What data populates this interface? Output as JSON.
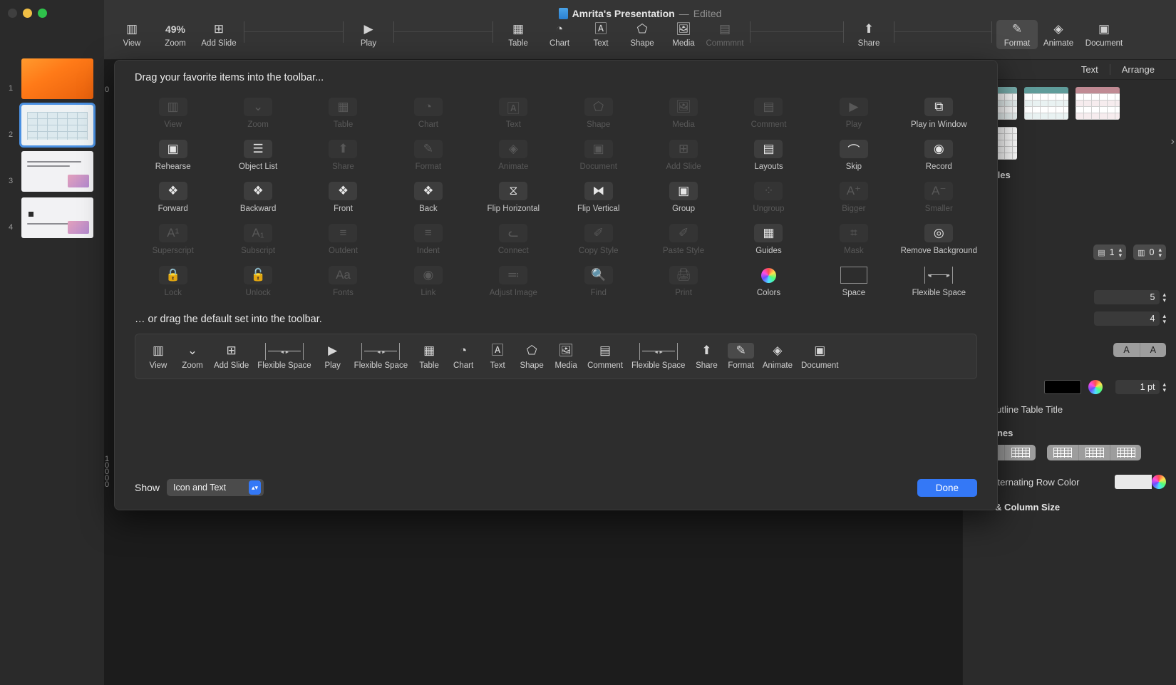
{
  "window": {
    "title": "Amrita's Presentation",
    "separator": "—",
    "edited": "Edited",
    "doc_icon": "document-icon"
  },
  "traffic_lights": {
    "close": "close",
    "minimize": "minimize",
    "maximize": "maximize"
  },
  "toolbar": {
    "items": [
      {
        "label": "View",
        "icon": "sidebar-icon",
        "state": "normal"
      },
      {
        "label": "Zoom",
        "icon": "49% ⌄",
        "value": "49%",
        "state": "normal"
      },
      {
        "label": "Add Slide",
        "icon": "plus-box-icon",
        "state": "normal"
      },
      {
        "label": "Play",
        "icon": "play-icon",
        "state": "normal"
      },
      {
        "label": "Table",
        "icon": "table-icon",
        "state": "normal"
      },
      {
        "label": "Chart",
        "icon": "chart-icon",
        "state": "normal"
      },
      {
        "label": "Text",
        "icon": "text-icon",
        "state": "normal"
      },
      {
        "label": "Shape",
        "icon": "shape-icon",
        "state": "normal"
      },
      {
        "label": "Media",
        "icon": "media-icon",
        "state": "normal"
      },
      {
        "label": "Commmnt",
        "icon": "comment-icon",
        "state": "dim"
      },
      {
        "label": "Share",
        "icon": "share-icon",
        "state": "normal"
      },
      {
        "label": "Format",
        "icon": "format-brush-icon",
        "state": "active"
      },
      {
        "label": "Animate",
        "icon": "animate-icon",
        "state": "normal"
      },
      {
        "label": "Document",
        "icon": "document-panel-icon",
        "state": "normal"
      }
    ]
  },
  "slides": [
    {
      "number": "1",
      "kind": "orange-gradient",
      "selected": false
    },
    {
      "number": "2",
      "kind": "table",
      "selected": true
    },
    {
      "number": "3",
      "kind": "text",
      "selected": false
    },
    {
      "number": "4",
      "kind": "text",
      "selected": false
    }
  ],
  "ruler": {
    "left_top": "0",
    "left_bottom": "10000"
  },
  "inspector": {
    "tabs": [
      "Text",
      "Arrange"
    ],
    "styles_label": "le Styles",
    "row_count": "1",
    "column_count": "0",
    "value_a": "5",
    "value_b": "4",
    "text_size_seg": [
      "A",
      "A"
    ],
    "border_width": "1 pt",
    "outline_table_title": "Outline Table Title",
    "gridlines_title": "Gridlines",
    "alternating_row_color": "Alternating Row Color",
    "row_column_size": "Row & Column Size"
  },
  "sheet": {
    "heading": "Drag your favorite items into the toolbar...",
    "subheading": "… or drag the default set into the toolbar.",
    "show_label": "Show",
    "show_value": "Icon and Text",
    "done_label": "Done",
    "palette": [
      {
        "label": "View",
        "icon": "sidebar-icon",
        "state": "dim"
      },
      {
        "label": "Zoom",
        "icon": "chevron-down-icon",
        "state": "dim"
      },
      {
        "label": "Table",
        "icon": "table-icon",
        "state": "dim"
      },
      {
        "label": "Chart",
        "icon": "chart-icon",
        "state": "dim"
      },
      {
        "label": "Text",
        "icon": "text-box-icon",
        "state": "dim"
      },
      {
        "label": "Shape",
        "icon": "shape-icon",
        "state": "dim"
      },
      {
        "label": "Media",
        "icon": "media-icon",
        "state": "dim"
      },
      {
        "label": "Comment",
        "icon": "comment-icon",
        "state": "dim"
      },
      {
        "label": "Play",
        "icon": "play-icon",
        "state": "dim"
      },
      {
        "label": "Play in Window",
        "icon": "play-window-icon",
        "state": "lit"
      },
      {
        "label": "Rehearse",
        "icon": "rehearse-icon",
        "state": "lit"
      },
      {
        "label": "Object List",
        "icon": "list-icon",
        "state": "lit"
      },
      {
        "label": "Share",
        "icon": "share-icon",
        "state": "dim"
      },
      {
        "label": "Format",
        "icon": "format-brush-icon",
        "state": "dim"
      },
      {
        "label": "Animate",
        "icon": "animate-icon",
        "state": "dim"
      },
      {
        "label": "Document",
        "icon": "document-panel-icon",
        "state": "dim"
      },
      {
        "label": "Add Slide",
        "icon": "plus-box-icon",
        "state": "dim"
      },
      {
        "label": "Layouts",
        "icon": "layouts-icon",
        "state": "lit"
      },
      {
        "label": "Skip",
        "icon": "skip-icon",
        "state": "lit"
      },
      {
        "label": "Record",
        "icon": "record-icon",
        "state": "lit"
      },
      {
        "label": "Forward",
        "icon": "forward-layer-icon",
        "state": "lit"
      },
      {
        "label": "Backward",
        "icon": "backward-layer-icon",
        "state": "lit"
      },
      {
        "label": "Front",
        "icon": "front-layer-icon",
        "state": "lit"
      },
      {
        "label": "Back",
        "icon": "back-layer-icon",
        "state": "lit"
      },
      {
        "label": "Flip Horizontal",
        "icon": "flip-horizontal-icon",
        "state": "lit"
      },
      {
        "label": "Flip Vertical",
        "icon": "flip-vertical-icon",
        "state": "lit"
      },
      {
        "label": "Group",
        "icon": "group-icon",
        "state": "lit"
      },
      {
        "label": "Ungroup",
        "icon": "ungroup-icon",
        "state": "dim"
      },
      {
        "label": "Bigger",
        "icon": "font-bigger-icon",
        "state": "dim"
      },
      {
        "label": "Smaller",
        "icon": "font-smaller-icon",
        "state": "dim"
      },
      {
        "label": "Superscript",
        "icon": "superscript-icon",
        "state": "dim"
      },
      {
        "label": "Subscript",
        "icon": "subscript-icon",
        "state": "dim"
      },
      {
        "label": "Outdent",
        "icon": "outdent-icon",
        "state": "dim"
      },
      {
        "label": "Indent",
        "icon": "indent-icon",
        "state": "dim"
      },
      {
        "label": "Connect",
        "icon": "connect-icon",
        "state": "dim"
      },
      {
        "label": "Copy Style",
        "icon": "copy-style-icon",
        "state": "dim"
      },
      {
        "label": "Paste Style",
        "icon": "paste-style-icon",
        "state": "dim"
      },
      {
        "label": "Guides",
        "icon": "guides-icon",
        "state": "lit"
      },
      {
        "label": "Mask",
        "icon": "mask-icon",
        "state": "dim"
      },
      {
        "label": "Remove Background",
        "icon": "remove-background-icon",
        "state": "lit"
      },
      {
        "label": "Lock",
        "icon": "lock-icon",
        "state": "dim"
      },
      {
        "label": "Unlock",
        "icon": "unlock-icon",
        "state": "dim"
      },
      {
        "label": "Fonts",
        "icon": "fonts-icon",
        "state": "dim"
      },
      {
        "label": "Link",
        "icon": "link-icon",
        "state": "dim"
      },
      {
        "label": "Adjust Image",
        "icon": "adjust-image-icon",
        "state": "dim"
      },
      {
        "label": "Find",
        "icon": "find-icon",
        "state": "dim"
      },
      {
        "label": "Print",
        "icon": "print-icon",
        "state": "dim"
      },
      {
        "label": "Colors",
        "icon": "colors-wheel-icon",
        "state": "lit"
      },
      {
        "label": "Space",
        "icon": "space-icon",
        "state": "nobg"
      },
      {
        "label": "Flexible Space",
        "icon": "flexible-space-icon",
        "state": "nobg"
      }
    ],
    "default_set": [
      {
        "label": "View",
        "icon": "sidebar-icon"
      },
      {
        "label": "Zoom",
        "icon": "chevron-down-icon"
      },
      {
        "label": "Add Slide",
        "icon": "plus-box-icon"
      },
      {
        "label": "Flexible Space",
        "icon": "flexible-space-icon"
      },
      {
        "label": "Play",
        "icon": "play-icon"
      },
      {
        "label": "Flexible Space",
        "icon": "flexible-space-icon"
      },
      {
        "label": "Table",
        "icon": "table-icon"
      },
      {
        "label": "Chart",
        "icon": "chart-icon"
      },
      {
        "label": "Text",
        "icon": "text-box-icon"
      },
      {
        "label": "Shape",
        "icon": "shape-icon"
      },
      {
        "label": "Media",
        "icon": "media-icon"
      },
      {
        "label": "Comment",
        "icon": "comment-icon"
      },
      {
        "label": "Flexible Space",
        "icon": "flexible-space-icon"
      },
      {
        "label": "Share",
        "icon": "share-icon"
      },
      {
        "label": "Format",
        "icon": "format-brush-icon"
      },
      {
        "label": "Animate",
        "icon": "animate-icon"
      },
      {
        "label": "Document",
        "icon": "document-panel-icon"
      }
    ]
  },
  "colors": {
    "accent": "#3478f6",
    "sheet_bg": "#2d2d2d",
    "toolbar_bg": "#353535",
    "inspector_bg": "#2b2b2b"
  }
}
